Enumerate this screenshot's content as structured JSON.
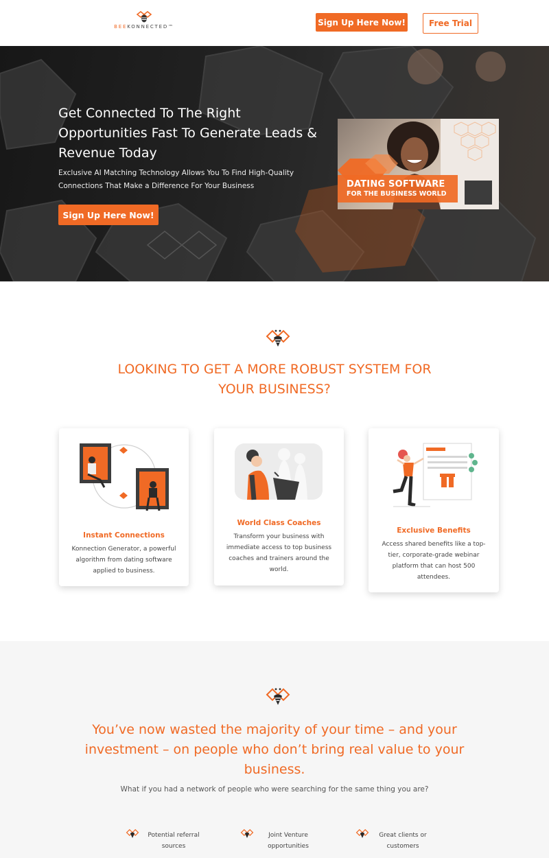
{
  "header": {
    "logo_bee": "BEE",
    "logo_rest": "KONNECTED",
    "logo_tm": "™",
    "signup_label": "Sign Up Here Now!",
    "trial_label": "Free Trial"
  },
  "hero": {
    "title": "Get Connected To The Right Opportunities Fast To Generate Leads & Revenue Today",
    "subtitle": "Exclusive AI Matching Technology Allows You To Find High-Quality Connections That Make a Difference For Your Business",
    "cta_label": "Sign Up Here Now!",
    "promo_line1": "DATING SOFTWARE",
    "promo_line2": "FOR THE BUSINESS WORLD"
  },
  "robust": {
    "title": "LOOKING TO GET A MORE ROBUST SYSTEM FOR YOUR BUSINESS?",
    "cards": [
      {
        "title": "Instant Connections",
        "text": "Konnection Generator, a powerful algorithm from dating software applied to business."
      },
      {
        "title": "World Class Coaches",
        "text": "Transform your business with immediate access to top business coaches and trainers around the world."
      },
      {
        "title": "Exclusive Benefits",
        "text": "Access shared benefits like a top-tier, corporate-grade webinar platform that can host 500 attendees."
      }
    ]
  },
  "wasted": {
    "title": "You’ve now wasted the majority of your time – and your investment – on people who don’t bring real value to your business.",
    "subtitle": "What if you had a network of people who were searching for the same thing you are?",
    "features": [
      {
        "label": "Potential referral sources"
      },
      {
        "label": "Joint Venture opportunities"
      },
      {
        "label": "Great clients or customers"
      }
    ]
  },
  "colors": {
    "accent": "#f06a25",
    "dark": "#1c1c1c",
    "light_bg": "#f6f6f6"
  }
}
